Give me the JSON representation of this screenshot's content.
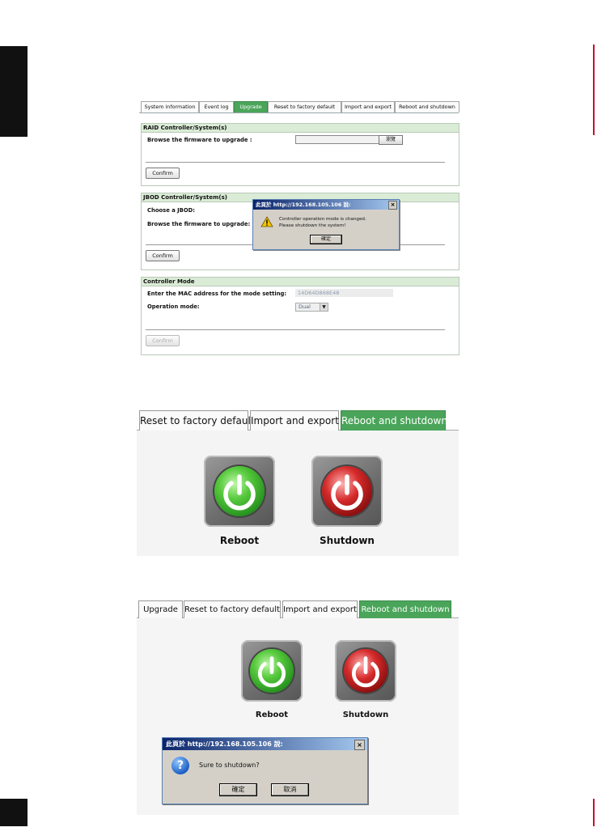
{
  "panel1": {
    "tabs": [
      "System information",
      "Event log",
      "Upgrade",
      "Reset to factory default",
      "Import and export",
      "Reboot and shutdown"
    ],
    "raid": {
      "title": "RAID Controller/System(s)",
      "browse_label": "Browse the firmware to upgrade :",
      "browse_button": "瀏覽",
      "confirm": "Confirm"
    },
    "jbod": {
      "title": "JBOD Controller/System(s)",
      "choose_label": "Choose a JBOD:",
      "browse_label": "Browse the firmware to upgrade:",
      "confirm": "Confirm"
    },
    "mode": {
      "title": "Controller Mode",
      "mac_label": "Enter the MAC address for the mode setting:",
      "mac_value": "14D64D868E48",
      "op_label": "Operation mode:",
      "op_value": "Dual",
      "confirm": "Confirm"
    },
    "alert": {
      "title": "此頁於 http://192.168.105.106 說:",
      "line1": "Controller operation mode is changed.",
      "line2": "Please shutdown the system!",
      "ok": "確定"
    }
  },
  "panel2": {
    "tabs": [
      "Reset to factory default",
      "Import and export",
      "Reboot and shutdown"
    ],
    "reboot_label": "Reboot",
    "shutdown_label": "Shutdown"
  },
  "panel3": {
    "tabs": [
      "Upgrade",
      "Reset to factory default",
      "Import and export",
      "Reboot and shutdown"
    ],
    "reboot_label": "Reboot",
    "shutdown_label": "Shutdown",
    "dialog": {
      "title": "此頁於 http://192.168.105.106 說:",
      "message": "Sure to shutdown?",
      "ok": "確定",
      "cancel": "取消"
    }
  },
  "colors": {
    "active_tab": "#4aa55a",
    "section_header": "#dbecd6",
    "reboot_green": "#3fb52e",
    "shutdown_red": "#c81f1f",
    "margin_tab": "#111111",
    "margin_line": "#c8102e"
  },
  "icons": [
    "power-icon",
    "warning-icon",
    "question-icon",
    "close-icon",
    "dropdown-arrow-icon"
  ]
}
